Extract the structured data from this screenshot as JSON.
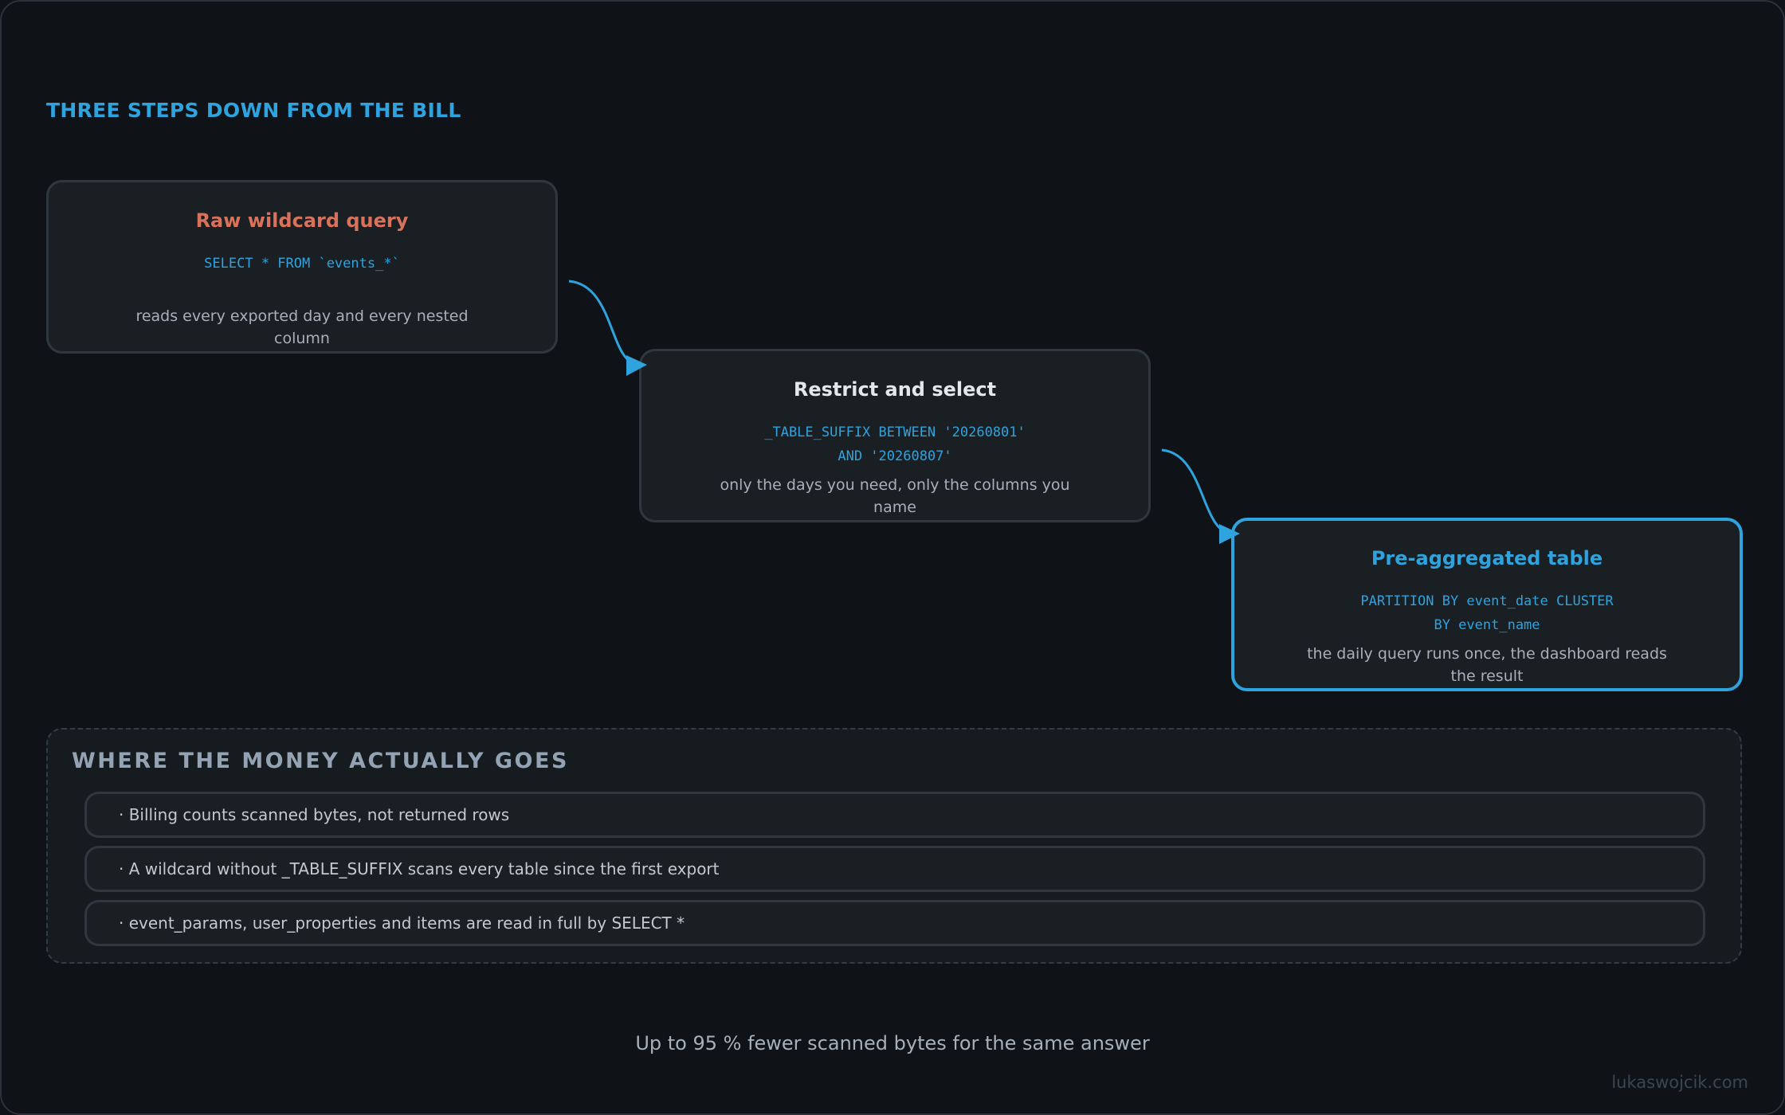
{
  "title": "THREE STEPS DOWN FROM THE BILL",
  "steps": [
    {
      "title": "Raw wildcard query",
      "code": [
        "SELECT * FROM `events_*`"
      ],
      "description": "reads every exported day and every nested column",
      "title_color": "#d9725a"
    },
    {
      "title": "Restrict and select",
      "code": [
        "_TABLE_SUFFIX BETWEEN '20260801'",
        "AND '20260807'"
      ],
      "description": "only the days you need, only the columns you name",
      "title_color": "#e4e8ec"
    },
    {
      "title": "Pre-aggregated table",
      "code": [
        "PARTITION BY event_date CLUSTER",
        "BY event_name"
      ],
      "description": "the daily query runs once, the dashboard reads the result",
      "title_color": "#2ea3de"
    }
  ],
  "money_panel": {
    "title": "WHERE THE MONEY ACTUALLY GOES",
    "items": [
      "· Billing counts scanned bytes, not returned rows",
      "· A wildcard without _TABLE_SUFFIX scans every table since the first export",
      "· event_params, user_properties and items are read in full by SELECT *"
    ]
  },
  "footer": "Up to 95 % fewer scanned bytes for the same answer",
  "watermark": "lukaswojcik.com",
  "colors": {
    "accent": "#2ea3de",
    "warning": "#d9725a",
    "background": "#0f1317",
    "card": "#1a1f24"
  }
}
